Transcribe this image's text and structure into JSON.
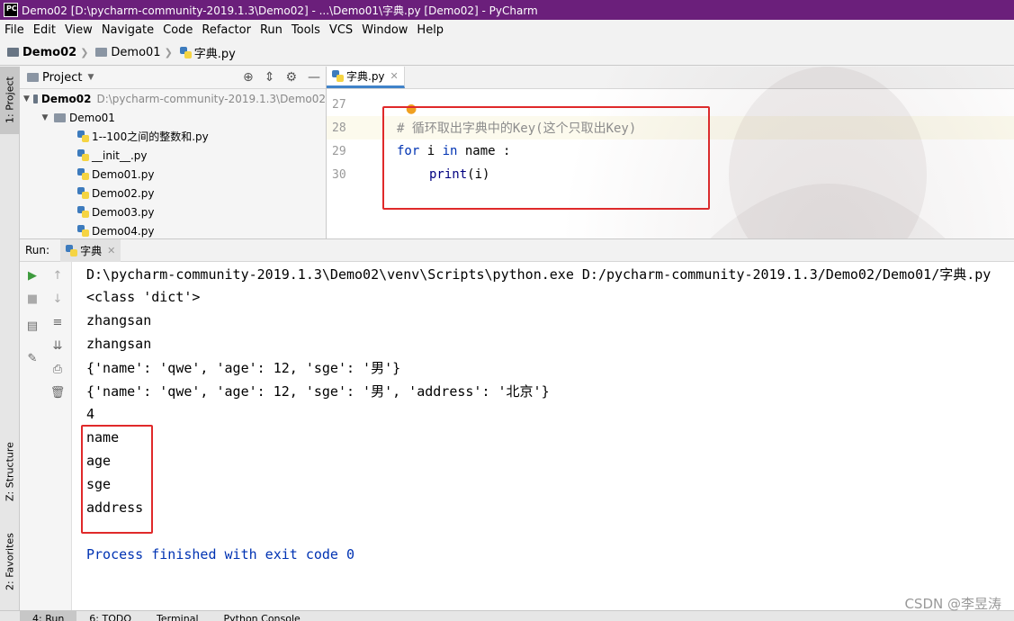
{
  "window": {
    "title": "Demo02 [D:\\pycharm-community-2019.1.3\\Demo02] - ...\\Demo01\\字典.py [Demo02] - PyCharm",
    "logo": "PC"
  },
  "menu": [
    "File",
    "Edit",
    "View",
    "Navigate",
    "Code",
    "Refactor",
    "Run",
    "Tools",
    "VCS",
    "Window",
    "Help"
  ],
  "breadcrumbs": [
    "Demo02",
    "Demo01",
    "字典.py"
  ],
  "left_strip": {
    "project_tab": "1: Project",
    "structure_tab": "Z: Structure",
    "favorites_tab": "2: Favorites"
  },
  "project": {
    "header": "Project",
    "root": {
      "name": "Demo02",
      "path": "D:\\pycharm-community-2019.1.3\\Demo02"
    },
    "folder": "Demo01",
    "files": [
      "1--100之间的整数和.py",
      "__init__.py",
      "Demo01.py",
      "Demo02.py",
      "Demo03.py",
      "Demo04.py"
    ]
  },
  "editor": {
    "tab_label": "字典.py",
    "lines": [
      {
        "num": "27",
        "comment": "",
        "kw1": "",
        "txt1": "",
        "kw2": "",
        "txt2": "",
        "fn": "",
        "txt3": ""
      },
      {
        "num": "28",
        "comment": "# 循环取出字典中的Key(这个只取出Key)",
        "kw1": "",
        "txt1": "",
        "kw2": "",
        "txt2": "",
        "fn": "",
        "txt3": ""
      },
      {
        "num": "29",
        "comment": "",
        "kw1": "for",
        "txt1": " i ",
        "kw2": "in",
        "txt2": " name :",
        "fn": "",
        "txt3": ""
      },
      {
        "num": "30",
        "comment": "",
        "kw1": "",
        "txt1": "",
        "kw2": "",
        "txt2": "",
        "fn": "print",
        "txt3": "(i)"
      }
    ]
  },
  "run": {
    "label": "Run:",
    "tab_label": "字典",
    "output": [
      "D:\\pycharm-community-2019.1.3\\Demo02\\venv\\Scripts\\python.exe D:/pycharm-community-2019.1.3/Demo02/Demo01/字典.py",
      "<class 'dict'>",
      "zhangsan",
      "zhangsan",
      "{'name': 'qwe', 'age': 12, 'sge': '男'}",
      "{'name': 'qwe', 'age': 12, 'sge': '男', 'address': '北京'}",
      "4",
      "name",
      "age",
      "sge",
      "address",
      "",
      "Process finished with exit code 0"
    ]
  },
  "bottom_tabs": [
    "4: Run",
    "6: TODO",
    "Terminal",
    "Python Console"
  ],
  "watermark": "CSDN @李昱涛",
  "colors": {
    "title_bar": "#6b1f7b",
    "highlight_box": "#e0292a",
    "keyword": "#0033b3",
    "comment": "#8c8c8c"
  }
}
